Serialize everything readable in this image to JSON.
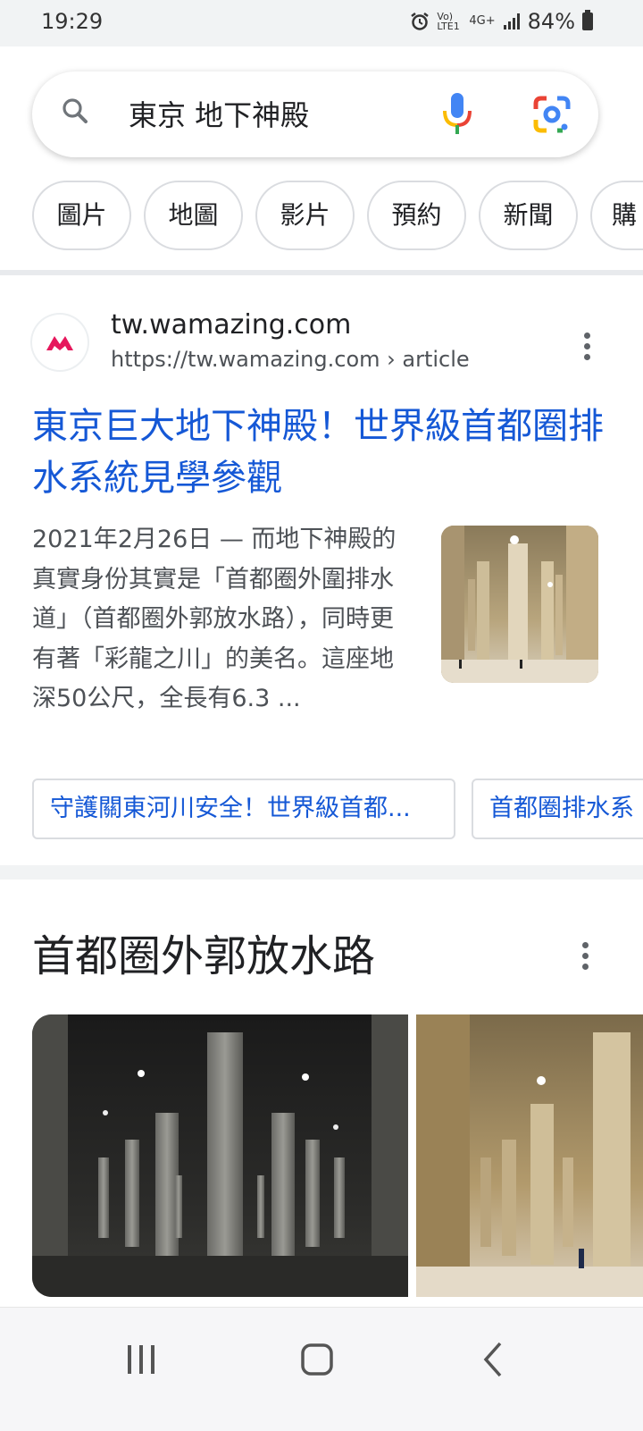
{
  "status_bar": {
    "time": "19:29",
    "network_label": "Vo) LTE1",
    "data_label": "4G+",
    "battery_text": "84%"
  },
  "search": {
    "query": "東京 地下神殿",
    "icons": [
      "search-icon",
      "mic-icon",
      "google-lens-icon"
    ]
  },
  "filter_chips": [
    "圖片",
    "地圖",
    "影片",
    "預約",
    "新聞",
    "購"
  ],
  "result": {
    "site_name": "tw.wamazing.com",
    "url": "https://tw.wamazing.com › article",
    "title": "東京巨大地下神殿！世界級首都圈排水系統見學參觀",
    "snippet": "2021年2月26日 — 而地下神殿的真實身份其實是「首都圈外圍排水道」（首都圈外郭放水路），同時更有著「彩龍之川」的美名。這座地深50公尺，全長有6.3 ...",
    "sitelinks": [
      "守護關東河川安全！世界級首都...",
      "首都圈排水系"
    ],
    "brand_color": "#e6175c"
  },
  "knowledge_section": {
    "title": "首都圈外郭放水路"
  },
  "nav_bar": {
    "icons": [
      "recents-icon",
      "home-icon",
      "back-icon"
    ]
  },
  "colors": {
    "link_blue": "#1558d6",
    "text_gray": "#4d5156"
  }
}
